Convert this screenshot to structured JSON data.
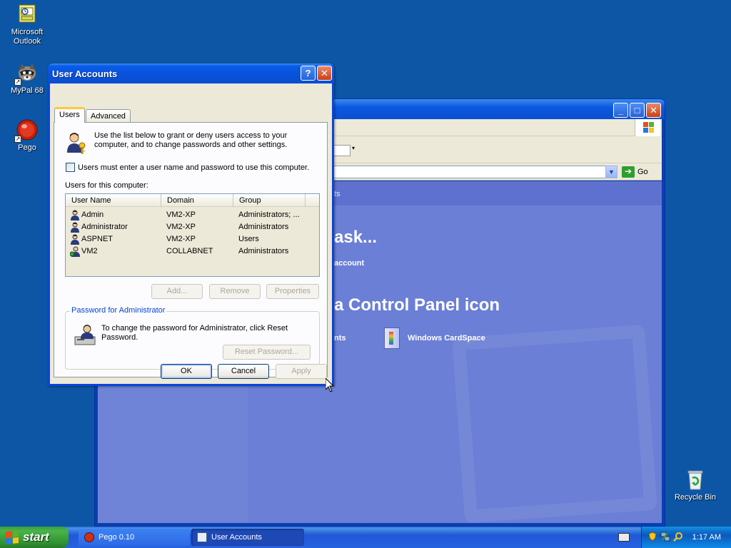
{
  "desktop": {
    "icons": [
      {
        "name": "outlook",
        "label_line1": "Microsoft",
        "label_line2": "Outlook"
      },
      {
        "name": "mypal",
        "label_line1": "MyPal 68",
        "label_line2": ""
      },
      {
        "name": "pego",
        "label_line1": "Pego",
        "label_line2": ""
      },
      {
        "name": "recycle",
        "label_line1": "Recycle Bin",
        "label_line2": ""
      }
    ]
  },
  "control_panel": {
    "address_go": "Go",
    "header_text": "ts",
    "task_heading": "ask...",
    "task_link": "account",
    "icon_heading": "a Control Panel icon",
    "item_left": "nts",
    "item_cardspace": "Windows CardSpace"
  },
  "dialog": {
    "title": "User Accounts",
    "help_btn": "?",
    "close_btn": "✕",
    "tabs": [
      "Users",
      "Advanced"
    ],
    "intro": "Use the list below to grant or deny users access to your computer, and to change passwords and other settings.",
    "checkbox_label": "Users must enter a user name and password to use this computer.",
    "checkbox_checked": false,
    "users_label": "Users for this computer:",
    "columns": [
      "User Name",
      "Domain",
      "Group"
    ],
    "users": [
      {
        "name": "Admin",
        "domain": "VM2-XP",
        "group": "Administrators; ..."
      },
      {
        "name": "Administrator",
        "domain": "VM2-XP",
        "group": "Administrators"
      },
      {
        "name": "ASPNET",
        "domain": "VM2-XP",
        "group": "Users"
      },
      {
        "name": "VM2",
        "domain": "COLLABNET",
        "group": "Administrators"
      }
    ],
    "buttons": {
      "add": "Add...",
      "remove": "Remove",
      "properties": "Properties"
    },
    "password_group": "Password for Administrator",
    "password_text": "To change the password for Administrator, click Reset Password.",
    "reset_password": "Reset Password...",
    "ok": "OK",
    "cancel": "Cancel",
    "apply": "Apply"
  },
  "taskbar": {
    "start": "start",
    "tasks": [
      {
        "label": "Pego 0.10",
        "active": false
      },
      {
        "label": "User Accounts",
        "active": true
      }
    ],
    "clock": "1:17 AM"
  },
  "colors": {
    "desktop": "#0d56a6",
    "title_blue": "#0a5ce8",
    "dialog_face": "#ece9d8",
    "groupbox_title": "#0046d5",
    "start_green": "#3c9a3c"
  }
}
